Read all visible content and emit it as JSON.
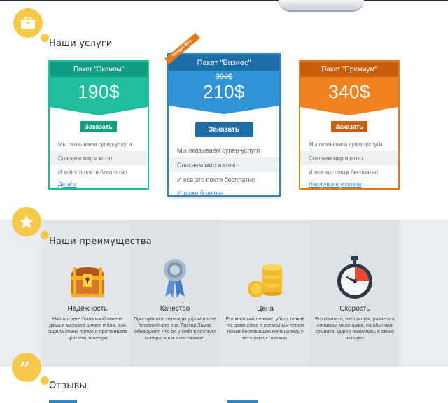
{
  "services": {
    "title": "Наши услуги",
    "cards": [
      {
        "package": "Пакет \"Эконом\"",
        "price": "190$",
        "button": "Заказать",
        "features": [
          "Мы оказываем супер-услуги",
          "Спасаем мир и котят",
          "И всё это почти бесплатно"
        ],
        "link": "Детали"
      },
      {
        "package": "Пакет \"Бизнес\"",
        "ribbon": "Скидка 30%",
        "old_price": "300$",
        "price": "210$",
        "button": "Заказать",
        "features": [
          "Мы оказываем супер-услуги",
          "Спасаем мир и котят",
          "И все это почти бесплатно"
        ],
        "link": "И даже больше"
      },
      {
        "package": "Пакет \"Премиум\"",
        "price": "340$",
        "button": "Заказать",
        "features": [
          "Мы оказываем супер-услуги",
          "Спасаем мир и котят",
          "И все это почти бесплатно"
        ],
        "link": "Наилучшие условия"
      }
    ]
  },
  "advantages": {
    "title": "Наши преимущества",
    "items": [
      {
        "name": "Надёжность",
        "desc": "На портрете была изображена дама в меховой шляпе и боа, она сидела очень прямо и протягивала зрителю тяжелую",
        "icon": "treasure-chest-icon"
      },
      {
        "name": "Качество",
        "desc": "Проснувшись однажды утром после беспокойного сна, Грегор Замза обнаружил, что он у себя в постели превратился в насекомое.",
        "icon": "award-ribbon-icon"
      },
      {
        "name": "Цена",
        "desc": "Его многочисленные, убого тонкие по сравнению с остальным телом ножки беспомощно копошились у него перед глазами.",
        "icon": "coins-icon"
      },
      {
        "name": "Скорость",
        "desc": "Его комната, настоящая, разве что слишком маленькая, но обычная комната, мирно покоилась в своих четырех",
        "icon": "stopwatch-icon"
      }
    ]
  },
  "reviews": {
    "title": "Отзывы"
  },
  "colors": {
    "econ": "#1fbe9c",
    "business": "#2a86c9",
    "premium": "#e8791a",
    "badge": "#f6c84a"
  }
}
